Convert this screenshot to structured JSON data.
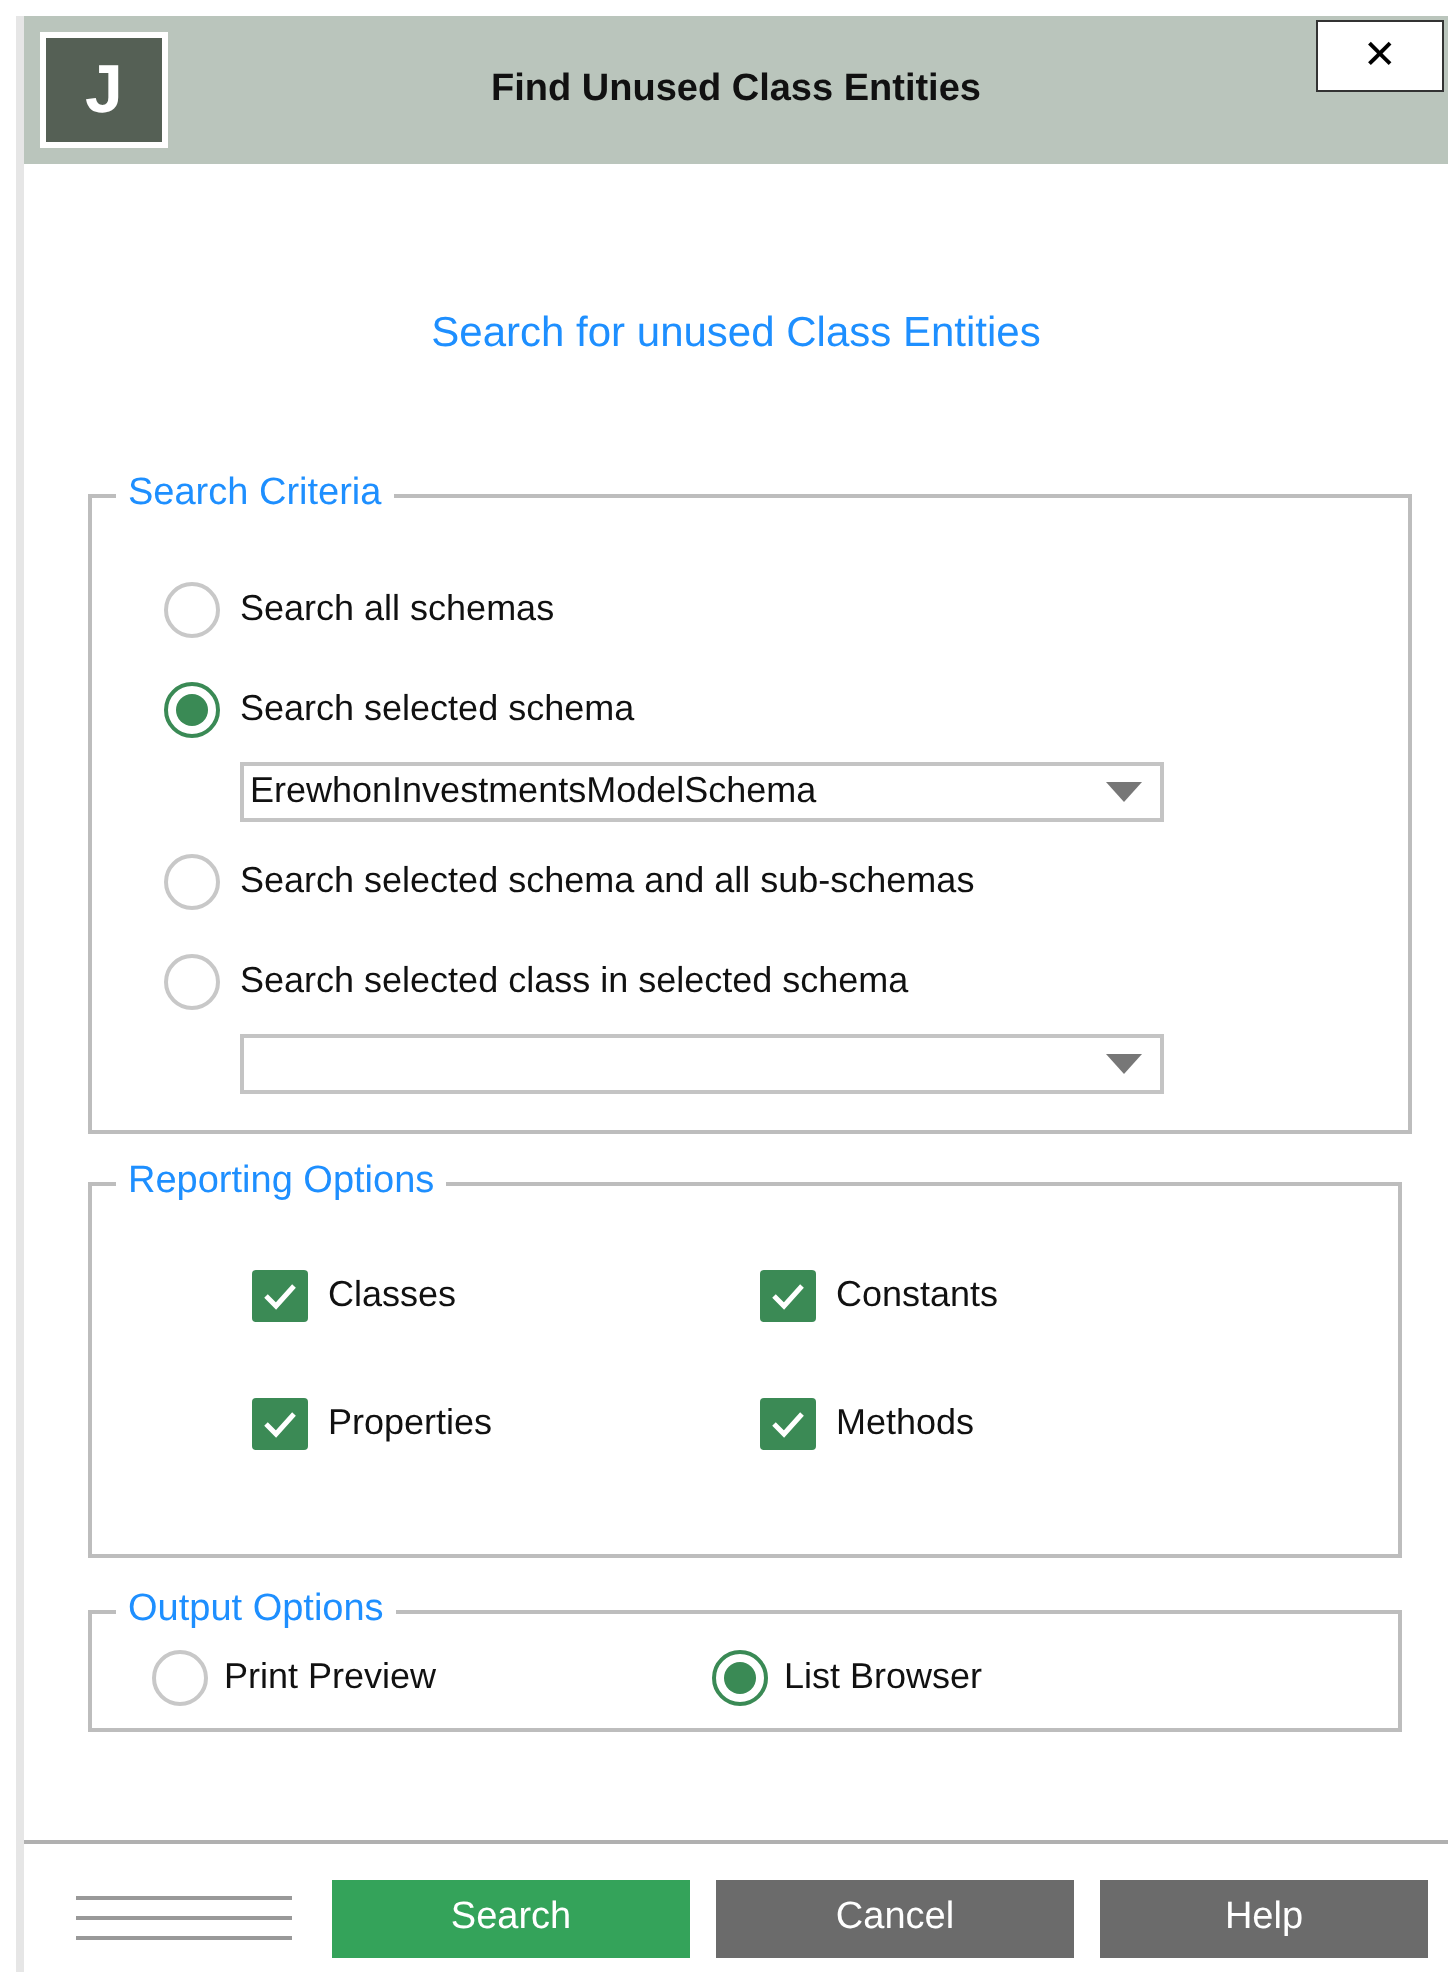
{
  "window": {
    "title": "Find Unused Class Entities",
    "logo_letter": "J",
    "close_label": "✕"
  },
  "heading": "Search for unused Class Entities",
  "search_criteria": {
    "legend": "Search Criteria",
    "options": [
      {
        "kind": "radio",
        "label": "Search all schemas",
        "selected": false
      },
      {
        "kind": "radio",
        "label": "Search selected schema",
        "selected": true
      },
      {
        "kind": "dropdown",
        "value": "ErewhonInvestmentsModelSchema"
      },
      {
        "kind": "radio",
        "label": "Search selected schema and all sub-schemas",
        "selected": false
      },
      {
        "kind": "radio",
        "label": "Search selected class in selected schema",
        "selected": false
      },
      {
        "kind": "dropdown"
      }
    ]
  },
  "reporting_options": {
    "legend": "Reporting Options",
    "items": [
      {
        "label": "Classes",
        "checked": true
      },
      {
        "label": "Constants",
        "checked": true
      },
      {
        "label": "Properties",
        "checked": true
      },
      {
        "label": "Methods",
        "checked": true
      }
    ]
  },
  "output_options": {
    "legend": "Output Options",
    "items": [
      {
        "label": "Print Preview",
        "selected": false
      },
      {
        "label": "List Browser",
        "selected": true
      }
    ]
  },
  "buttons": [
    {
      "label": "Search",
      "kind": "primary"
    },
    {
      "label": "Cancel",
      "kind": "secondary"
    },
    {
      "label": "Help",
      "kind": "secondary"
    }
  ]
}
